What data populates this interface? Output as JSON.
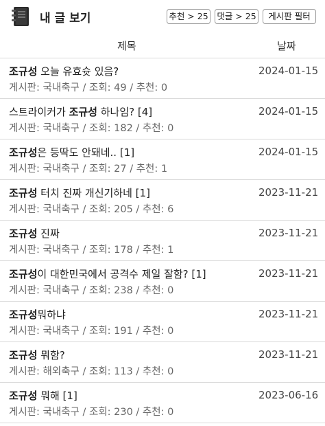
{
  "header": {
    "title": "내 글 보기",
    "buttons": {
      "recommend": "추천 > 25",
      "comments": "댓글 > 25",
      "board_filter": "게시판 필터"
    }
  },
  "table": {
    "columns": {
      "title": "제목",
      "date": "날짜"
    },
    "rows": [
      {
        "title_pre": "",
        "title_bold": "조규성",
        "title_post": " 오늘 유효슛 있음?",
        "meta": "게시판: 국내축구 / 조회: 49 / 추천: 0",
        "date": "2024-01-15"
      },
      {
        "title_pre": "스트라이커가 ",
        "title_bold": "조규성",
        "title_post": " 하나임? [4]",
        "meta": "게시판: 국내축구 / 조회: 182 / 추천: 0",
        "date": "2024-01-15"
      },
      {
        "title_pre": "",
        "title_bold": "조규성",
        "title_post": "은 등딱도 안돼네.. [1]",
        "meta": "게시판: 국내축구 / 조회: 27 / 추천: 1",
        "date": "2024-01-15"
      },
      {
        "title_pre": "",
        "title_bold": "조규성",
        "title_post": " 터치 진짜 개신기하네 [1]",
        "meta": "게시판: 국내축구 / 조회: 205 / 추천: 6",
        "date": "2023-11-21"
      },
      {
        "title_pre": "",
        "title_bold": "조규성",
        "title_post": " 진짜",
        "meta": "게시판: 국내축구 / 조회: 178 / 추천: 1",
        "date": "2023-11-21"
      },
      {
        "title_pre": "",
        "title_bold": "조규성",
        "title_post": "이 대한민국에서 공격수 제일 잘함? [1]",
        "meta": "게시판: 국내축구 / 조회: 238 / 추천: 0",
        "date": "2023-11-21"
      },
      {
        "title_pre": "",
        "title_bold": "조규성",
        "title_post": "뭐하냐",
        "meta": "게시판: 국내축구 / 조회: 191 / 추천: 0",
        "date": "2023-11-21"
      },
      {
        "title_pre": "",
        "title_bold": "조규성",
        "title_post": " 뭐함?",
        "meta": "게시판: 해외축구 / 조회: 113 / 추천: 0",
        "date": "2023-11-21"
      },
      {
        "title_pre": "",
        "title_bold": "조규성",
        "title_post": " 뭐해 [1]",
        "meta": "게시판: 국내축구 / 조회: 230 / 추천: 0",
        "date": "2023-06-16"
      }
    ]
  }
}
